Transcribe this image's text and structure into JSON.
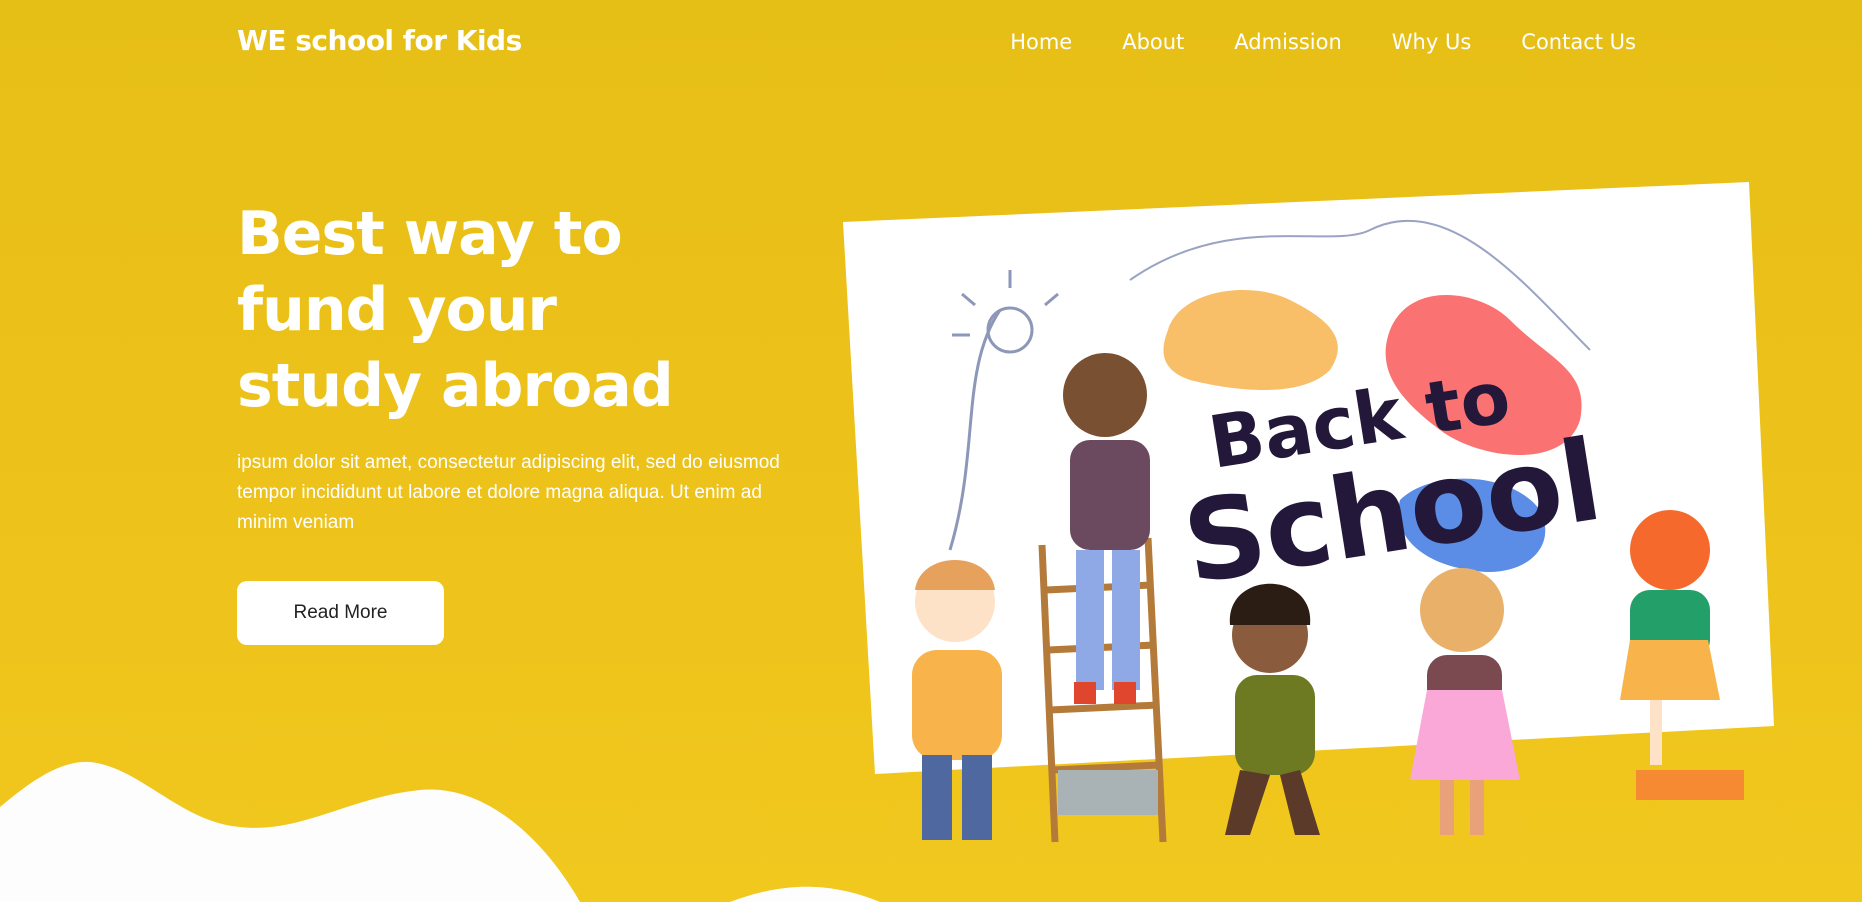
{
  "header": {
    "logo": "WE school for Kids",
    "nav": [
      "Home",
      "About",
      "Admission",
      "Why Us",
      "Contact Us"
    ]
  },
  "hero": {
    "title_lines": [
      "Best way to",
      "fund your",
      "study abroad"
    ],
    "description": "ipsum dolor sit amet, consectetur adipiscing elit, sed do eiusmod tempor incididunt ut labore et dolore magna aliqua. Ut enim ad minim veniam",
    "button_label": "Read More"
  },
  "illustration": {
    "line1": "Back to",
    "line2": "School"
  },
  "colors": {
    "background": "#ecc11a",
    "text": "#ffffff",
    "button_bg": "#ffffff",
    "button_text": "#222222"
  }
}
